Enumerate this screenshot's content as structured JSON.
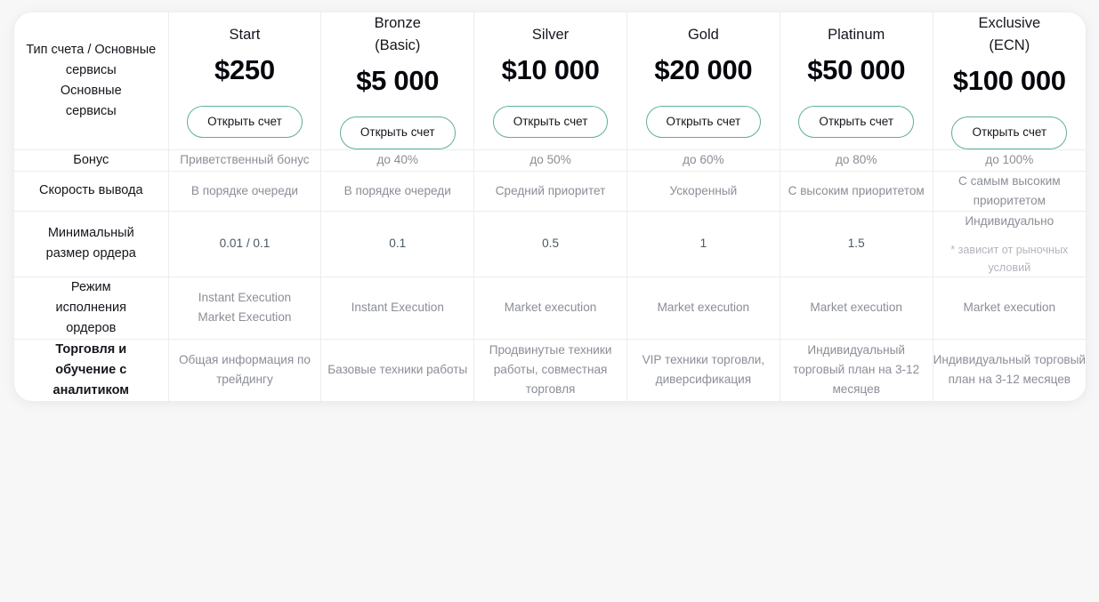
{
  "table": {
    "header": {
      "row_label": "Тип счета /\nОсновные\nсервисы",
      "cta_label": "Открыть счет",
      "plans": [
        {
          "name": "Start",
          "price": "$250"
        },
        {
          "name": "Bronze\n(Basic)",
          "price": "$5 000"
        },
        {
          "name": "Silver",
          "price": "$10 000"
        },
        {
          "name": "Gold",
          "price": "$20 000"
        },
        {
          "name": "Platinum",
          "price": "$50 000"
        },
        {
          "name": "Exclusive\n(ECN)",
          "price": "$100 000"
        }
      ]
    },
    "rows": [
      {
        "label": "Бонус",
        "values": [
          "Приветственный бонус",
          "до 40%",
          "до 50%",
          "до 60%",
          "до 80%",
          "до 100%"
        ]
      },
      {
        "label": "Скорость вывода",
        "values": [
          "В порядке очереди",
          "В порядке очереди",
          "Средний приоритет",
          "Ускоренный",
          "С высоким приоритетом",
          "С самым высоким приоритетом"
        ]
      },
      {
        "label": "Минимальный\nразмер ордера",
        "values": [
          "0.01 / 0.1",
          "0.1",
          "0.5",
          "1",
          "1.5",
          "Индивидуально"
        ],
        "note_index": 5,
        "note": "* зависит от рыночных условий"
      },
      {
        "label": "Режим\nисполнения\nордеров",
        "values": [
          "Instant Execution\nMarket Execution",
          "Instant Execution",
          "Market execution",
          "Market execution",
          "Market execution",
          "Market execution"
        ]
      },
      {
        "label": "Торговля и\nобучение с\nаналитиком",
        "label_strong": true,
        "values": [
          "Общая информация по трейдингу",
          "Базовые техники работы",
          "Продвинутые техники работы, совместная торговля",
          "VIP техники торговли, диверсификация",
          "Индивидуальный торговый план на 3-12 месяцев",
          "Индивидуальный торговый план на 3-12 месяцев"
        ]
      }
    ]
  },
  "colors": {
    "page_background": "#f7f7f8",
    "card_background": "#ffffff",
    "border": "#ececef",
    "cta_border": "#5fae9e",
    "label_text": "#14161c",
    "value_text": "#8b8e97",
    "price_text": "#05070c"
  }
}
